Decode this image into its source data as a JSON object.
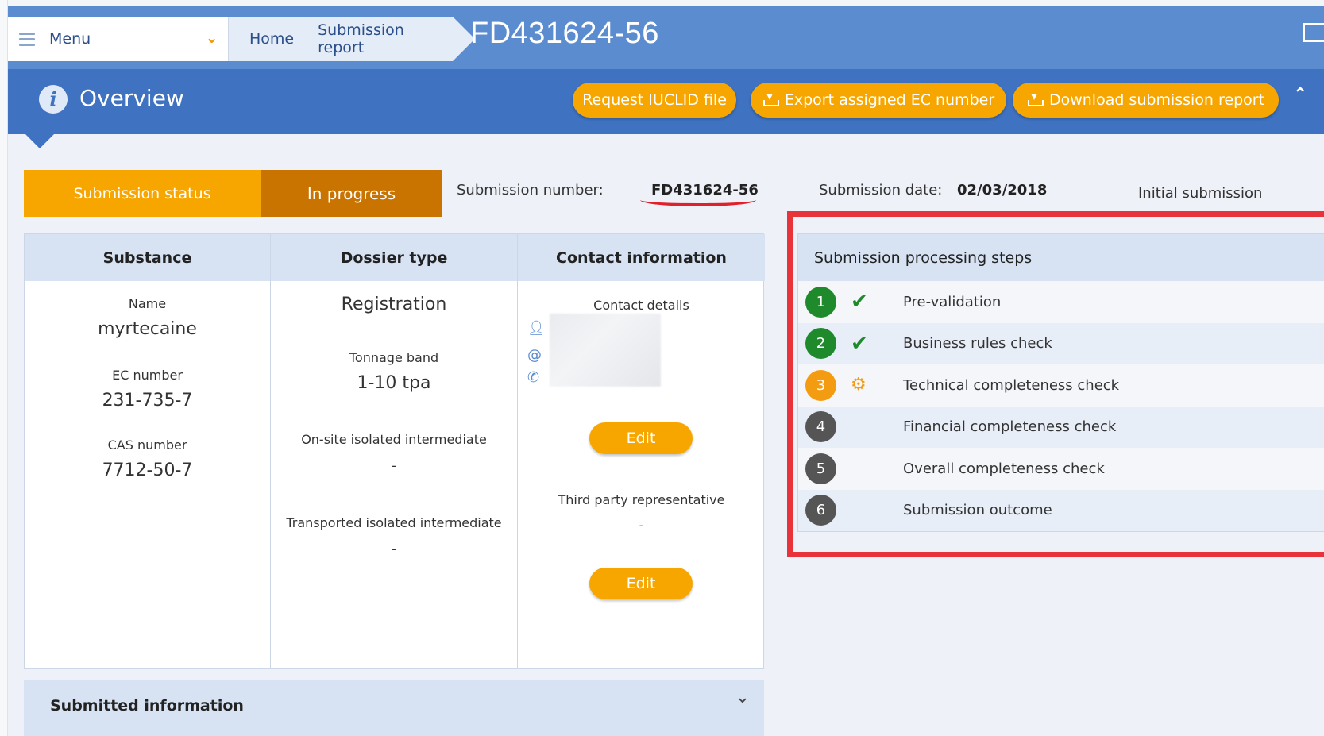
{
  "header": {
    "menu_label": "Menu",
    "breadcrumbs": [
      "Home",
      "Submission report"
    ],
    "page_title": "FD431624-56"
  },
  "overview": {
    "title": "Overview",
    "buttons": {
      "request_iuclid": "Request IUCLID file",
      "export_ec": "Export assigned EC number",
      "download_report": "Download submission report"
    }
  },
  "status": {
    "label": "Submission status",
    "value": "In progress",
    "submission_number_label": "Submission number:",
    "submission_number": "FD431624-56",
    "submission_date_label": "Submission date:",
    "submission_date": "02/03/2018",
    "submission_type": "Initial submission"
  },
  "substance": {
    "header": "Substance",
    "name_label": "Name",
    "name": "myrtecaine",
    "ec_label": "EC number",
    "ec": "231-735-7",
    "cas_label": "CAS number",
    "cas": "7712-50-7"
  },
  "dossier": {
    "header": "Dossier type",
    "type": "Registration",
    "tonnage_label": "Tonnage band",
    "tonnage": "1-10 tpa",
    "onsite_label": "On-site isolated intermediate",
    "onsite": "-",
    "transported_label": "Transported isolated intermediate",
    "transported": "-"
  },
  "contact": {
    "header": "Contact information",
    "details_label": "Contact details",
    "edit_label": "Edit",
    "third_party_label": "Third party representative",
    "third_party": "-",
    "edit2_label": "Edit"
  },
  "submitted_info": {
    "label": "Submitted information"
  },
  "processing": {
    "header": "Submission processing steps",
    "steps": [
      {
        "num": "1",
        "label": "Pre-validation",
        "state": "done"
      },
      {
        "num": "2",
        "label": "Business rules check",
        "state": "done"
      },
      {
        "num": "3",
        "label": "Technical completeness check",
        "state": "active"
      },
      {
        "num": "4",
        "label": "Financial completeness check",
        "state": "pending"
      },
      {
        "num": "5",
        "label": "Overall completeness check",
        "state": "pending"
      },
      {
        "num": "6",
        "label": "Submission outcome",
        "state": "pending"
      }
    ]
  },
  "colors": {
    "top_bar": "#5b8cd0",
    "overview_band": "#3f72c0",
    "accent_orange": "#f7a600",
    "status_dark_orange": "#c97300",
    "done_green": "#1e8a2c",
    "highlight_red": "#e8333b"
  }
}
